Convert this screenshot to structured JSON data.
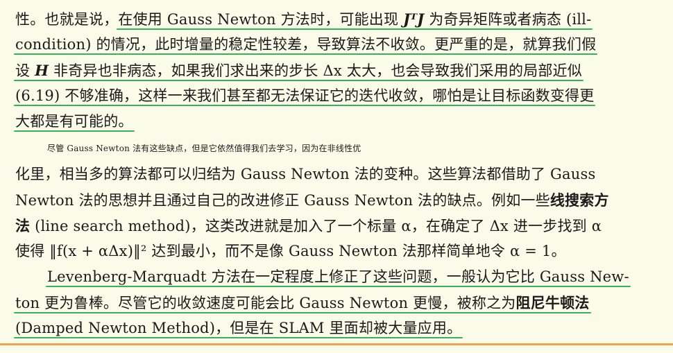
{
  "paragraph1": {
    "lines": [
      [
        "性。也就是说，",
        "在使用 Gauss Newton 方法时，可能出现 ",
        "JᵀJ",
        " 为奇异矩阵或者病态 (ill-"
      ],
      [
        "condition) 的情况，此时增量的稳定性较差，导致算法不收敛。更严重的是，就算我们假"
      ],
      [
        "设 ",
        "H",
        " 非奇异也非病态，如果我们求出来的步长 Δx 太大，也会导致我们采用的局部近似"
      ],
      [
        "(6.19) 不够准确，这样一来我们甚至都无法保证它的迭代收敛，哪怕是让目标函数变得更"
      ],
      [
        "大都是有可能的。"
      ]
    ]
  },
  "paragraph2": {
    "lines": [
      "尽管 Gauss Newton 法有这些缺点，但是它依然值得我们去学习，因为在非线性优",
      "化里，相当多的算法都可以归结为 Gauss Newton 法的变种。这些算法都借助了 Gauss",
      "Newton 法的思想并且通过自己的改进修正 Gauss Newton 法的缺点。例如一些",
      "法",
      " (line search method)，这类改进就是加入了一个标量 α，在确定了 Δx 进一步找到 α",
      "使得 ‖f(x + αΔx)‖² 达到最小，而不是像 Gauss Newton 法那样简单地令 α = 1。"
    ],
    "bold_term_a": "线搜索方",
    "bold_term_b": "法"
  },
  "paragraph3": {
    "line1_a": "Levenberg-Marquadt",
    "line1_b": " 方法在一定程度上修正了这些问题，一般认为它比 ",
    "line1_c": "Gauss New-",
    "line2_a": "ton",
    "line2_b": " 更为鲁棒。尽管它的收敛速度可能会比 ",
    "line2_c": "Gauss Newton",
    "line2_d": " 更慢，被称之为",
    "line2_bold": "阻尼牛顿法",
    "line3_a": "(Damped Newton Method)",
    "line3_b": "，但是在 ",
    "line3_c": "SLAM",
    "line3_d": " 里面却被大量应用。"
  }
}
